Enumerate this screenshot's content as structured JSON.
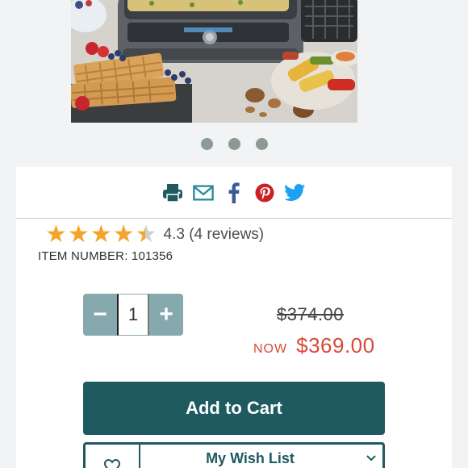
{
  "gallery": {
    "image_alt": "Griddle with pizza, waffles, grilled vegetables",
    "dot_count": 3
  },
  "share": {
    "icons": [
      "print-icon",
      "email-icon",
      "facebook-icon",
      "pinterest-icon",
      "twitter-icon"
    ]
  },
  "rating": {
    "stars": 4.3,
    "text": "4.3 (4 reviews)"
  },
  "item": {
    "number": "ITEM NUMBER: 101356"
  },
  "quantity": {
    "minus": "−",
    "value": "1",
    "plus": "+"
  },
  "price": {
    "original": "$374.00",
    "now_label": "NOW",
    "now_value": "$369.00"
  },
  "actions": {
    "add_to_cart": "Add to Cart",
    "wish_list": "My Wish List"
  },
  "colors": {
    "accent": "#1f5a60",
    "sale": "#d84a3a",
    "star": "#f5a42a",
    "stepper": "#86a9ae"
  }
}
